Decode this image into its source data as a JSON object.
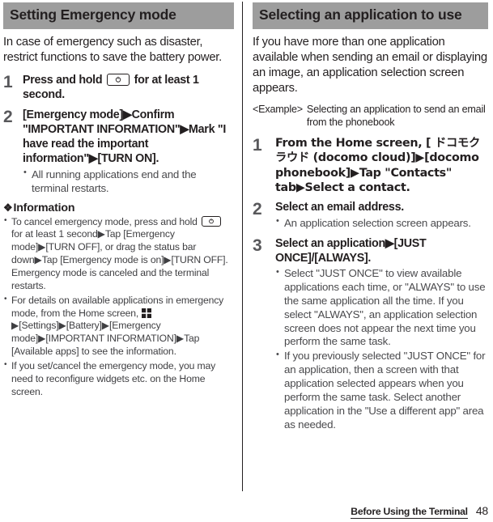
{
  "left_column": {
    "section_title": "Setting Emergency mode",
    "intro": "In case of emergency such as disaster, restrict functions to save the battery power.",
    "steps": [
      {
        "number": "1",
        "title_before_icon": "Press and hold",
        "icon": "power-key-icon",
        "title_after_icon": "for at least 1 second.",
        "notes": []
      },
      {
        "number": "2",
        "title": "[Emergency mode]▶Confirm \"IMPORTANT INFORMATION\"▶Mark \"I have read the important information\"▶[TURN ON].",
        "notes": [
          "All running applications end and the terminal restarts."
        ]
      }
    ],
    "information": {
      "symbol": "❖",
      "heading": "Information",
      "items": [
        {
          "text_part_1": "To cancel emergency mode, press and hold",
          "icon": "power-key-icon",
          "text_part_2": "for at least 1 second▶Tap [Emergency mode]▶[TURN OFF], or drag the status bar down▶Tap [Emergency mode is on]▶[TURN OFF]. Emergency mode is canceled and the terminal restarts."
        },
        {
          "text_part_1": "For details on available applications in emergency mode, from the Home screen,",
          "icon": "app-grid-icon",
          "text_part_2": "▶[Settings]▶[Battery]▶[Emergency mode]▶[IMPORTANT INFORMATION]▶Tap [Available apps] to see the information."
        },
        {
          "text_part_1": "If you set/cancel the emergency mode, you may need to reconfigure widgets etc. on the Home screen.",
          "icon": "",
          "text_part_2": ""
        }
      ]
    }
  },
  "right_column": {
    "section_title": "Selecting an application to use",
    "intro": "If you have more than one application available when sending an email or displaying an image, an application selection screen appears.",
    "example": {
      "label": "<Example>",
      "text": "Selecting an application to send an email from the phonebook"
    },
    "steps": [
      {
        "number": "1",
        "title": "From the Home screen, [ ドコモクラウド (docomo cloud)]▶[docomo phonebook]▶Tap \"Contacts\" tab▶Select a contact.",
        "notes": []
      },
      {
        "number": "2",
        "title": "Select an email address.",
        "notes": [
          "An application selection screen appears."
        ]
      },
      {
        "number": "3",
        "title": "Select an application▶[JUST ONCE]/[ALWAYS].",
        "notes": [
          "Select \"JUST ONCE\" to view available applications each time, or \"ALWAYS\" to use the same application all the time. If you select \"ALWAYS\", an application selection screen does not appear the next time you perform the same task.",
          "If you previously selected \"JUST ONCE\" for an application, then a screen with that application selected appears when you perform the same task. Select another application in the \"Use a different app\" area as needed."
        ]
      }
    ]
  },
  "footer": {
    "title": "Before Using the Terminal",
    "page_number": "48"
  },
  "colors": {
    "header_bar": "#9d9d9d",
    "text": "#231f20",
    "step_number": "#58585b",
    "note_text": "#4a4a4d"
  }
}
